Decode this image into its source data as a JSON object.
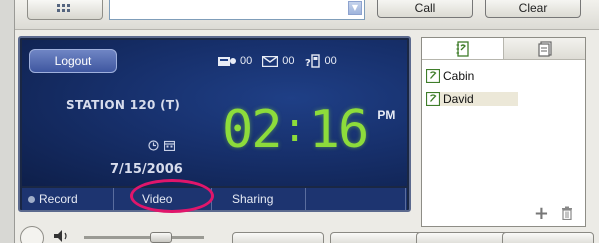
{
  "toolbar": {
    "address_value": "",
    "call_label": "Call",
    "clear_label": "Clear"
  },
  "display": {
    "logout_label": "Logout",
    "status": {
      "voicemail_count": "00",
      "message_count": "00",
      "missed_calls_count": "00"
    },
    "station_label": "STATION 120 (T)",
    "date": "7/15/2006",
    "time": {
      "hours": "02",
      "minutes": "16",
      "ampm": "PM"
    },
    "tabs": [
      {
        "label": "Record"
      },
      {
        "label": "Video"
      },
      {
        "label": "Sharing"
      },
      {
        "label": ""
      }
    ],
    "accent_color": "#8ddc3b",
    "highlight_color": "#e0166b"
  },
  "contacts": {
    "items": [
      {
        "name": "Cabin",
        "selected": false
      },
      {
        "name": "David",
        "selected": true
      }
    ]
  }
}
